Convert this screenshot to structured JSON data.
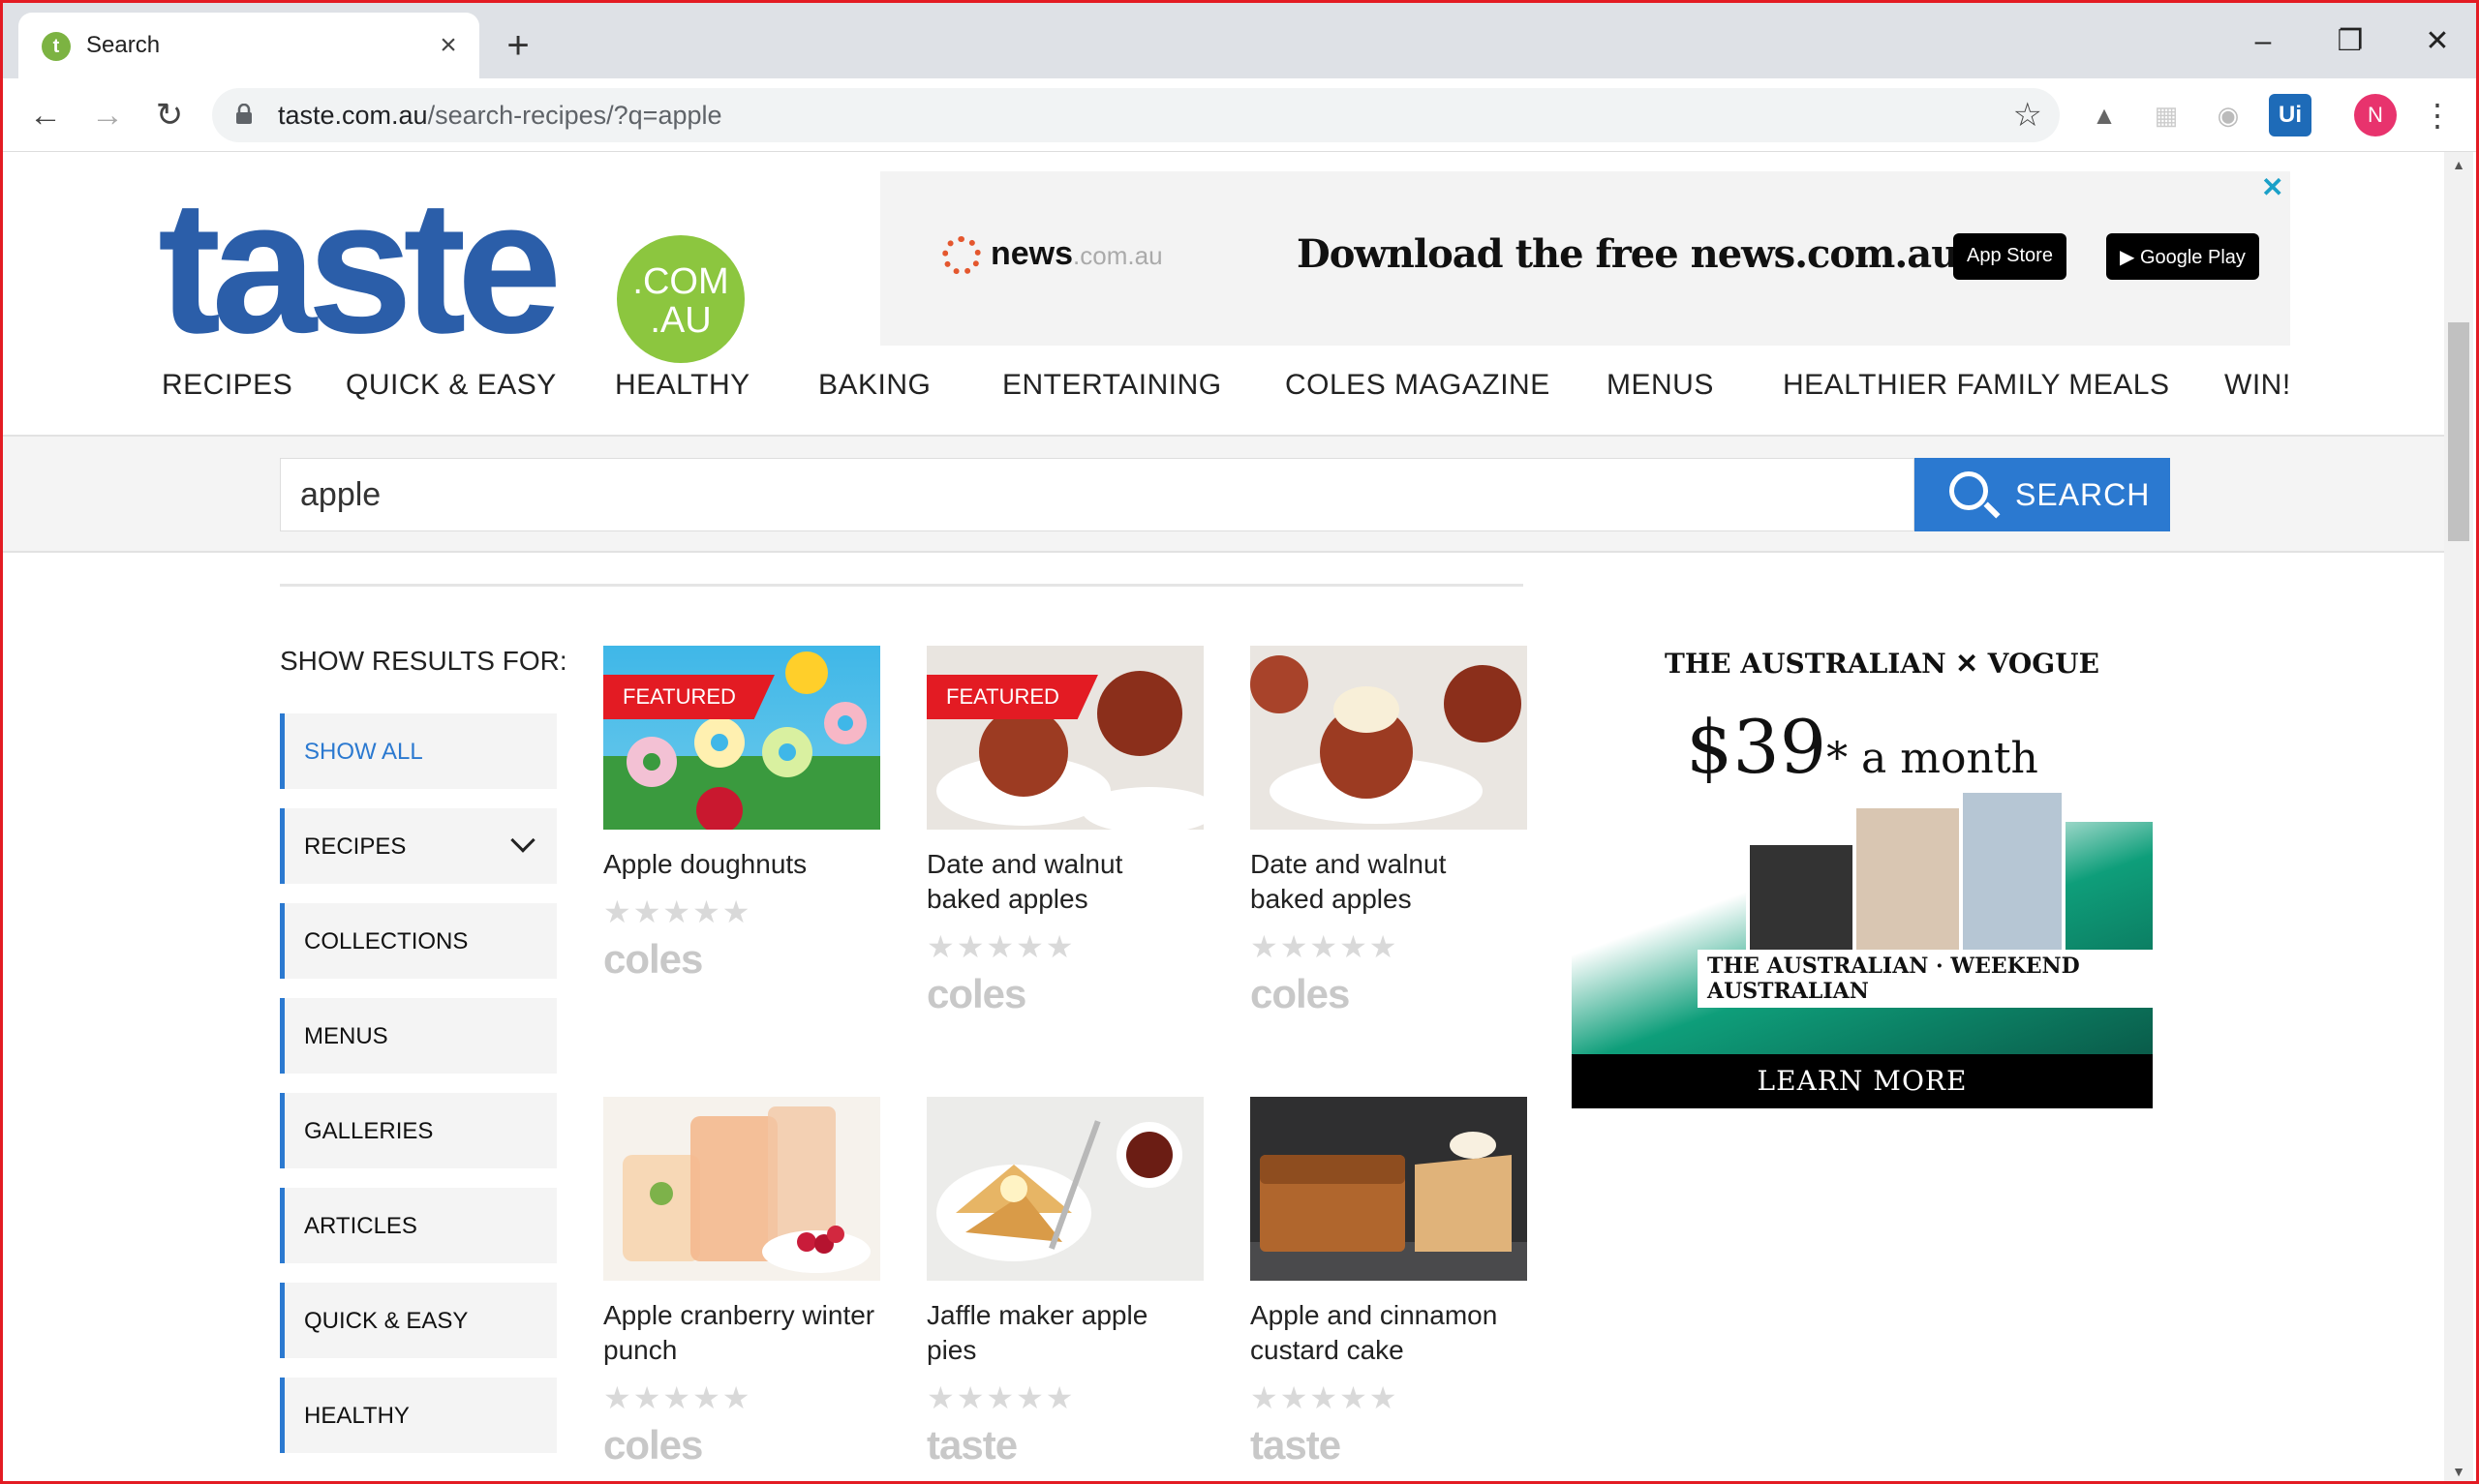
{
  "browser": {
    "tab_title": "Search",
    "url_domain": "taste.com.au",
    "url_path": "/search-recipes/?q=apple",
    "profile_initial": "N",
    "ext_ui_label": "Ui"
  },
  "site": {
    "logo_word": "taste",
    "logo_badge_line1": ".COM",
    "logo_badge_line2": ".AU"
  },
  "top_ad": {
    "news_logo": "news",
    "news_suffix": ".com.au",
    "headline": "Download the free news.com.au app",
    "app_store": "App Store",
    "google_play": "Google Play"
  },
  "nav": [
    "RECIPES",
    "QUICK & EASY",
    "HEALTHY",
    "BAKING",
    "ENTERTAINING",
    "COLES MAGAZINE",
    "MENUS",
    "HEALTHIER FAMILY MEALS",
    "WIN!"
  ],
  "search": {
    "value": "apple",
    "button_label": "SEARCH"
  },
  "filters": {
    "title": "SHOW RESULTS FOR:",
    "items": [
      "SHOW ALL",
      "RECIPES",
      "COLLECTIONS",
      "MENUS",
      "GALLERIES",
      "ARTICLES",
      "QUICK & EASY",
      "HEALTHY"
    ]
  },
  "results": [
    {
      "title": "Apple doughnuts",
      "featured": "FEATURED",
      "brand": "coles",
      "rating_stars": 0
    },
    {
      "title": "Date and walnut baked apples",
      "featured": "FEATURED",
      "brand": "coles",
      "rating_stars": 0
    },
    {
      "title": "Date and walnut baked apples",
      "featured": "",
      "brand": "coles",
      "rating_stars": 0
    },
    {
      "title": "Apple cranberry winter punch",
      "featured": "",
      "brand": "coles",
      "rating_stars": 0
    },
    {
      "title": "Jaffle maker apple pies",
      "featured": "",
      "brand": "taste",
      "rating_stars": 0
    },
    {
      "title": "Apple and cinnamon custard cake",
      "featured": "",
      "brand": "taste",
      "rating_stars": 0
    }
  ],
  "side_ad": {
    "brands": "THE AUSTRALIAN  ✕  VOGUE",
    "price": "$39",
    "price_suffix": "* a month",
    "paper": "THE AUSTRALIAN · WEEKEND AUSTRALIAN",
    "cta": "LEARN MORE"
  },
  "colors": {
    "brand_blue": "#2b5ea9",
    "brand_green": "#8cc63f",
    "featured_red": "#e31b23",
    "search_blue": "#2b79d0"
  }
}
